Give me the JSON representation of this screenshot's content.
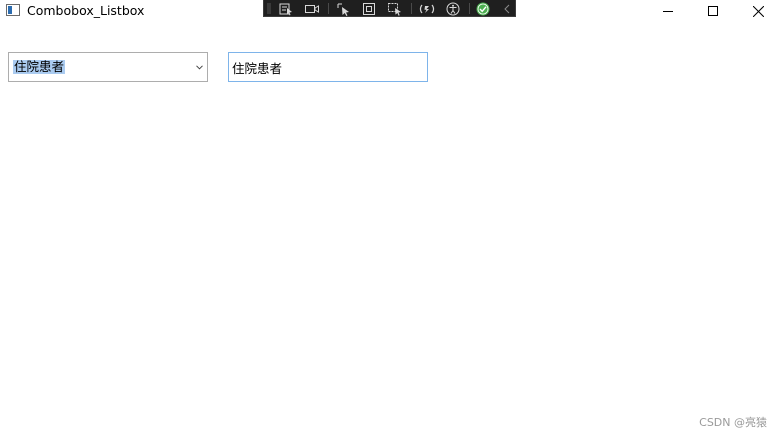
{
  "window": {
    "title": "Combobox_Listbox"
  },
  "debug_toolbar": {
    "icons": [
      "select-element-icon",
      "record-icon",
      "pointer-select-icon",
      "layout-adorner-icon",
      "track-focus-icon",
      "hot-reload-icon",
      "accessibility-icon",
      "binding-ok-icon",
      "collapse-chevron-icon"
    ]
  },
  "combobox": {
    "selected_value": "住院患者"
  },
  "textbox": {
    "value": "住院患者"
  },
  "watermark": {
    "text": "CSDN @亮猿"
  },
  "colors": {
    "selection_highlight": "#aacbf0",
    "textbox_focus_border": "#7eb4ea",
    "toolbar_bg": "#1f1f1f",
    "check_green": "#4caf50"
  }
}
